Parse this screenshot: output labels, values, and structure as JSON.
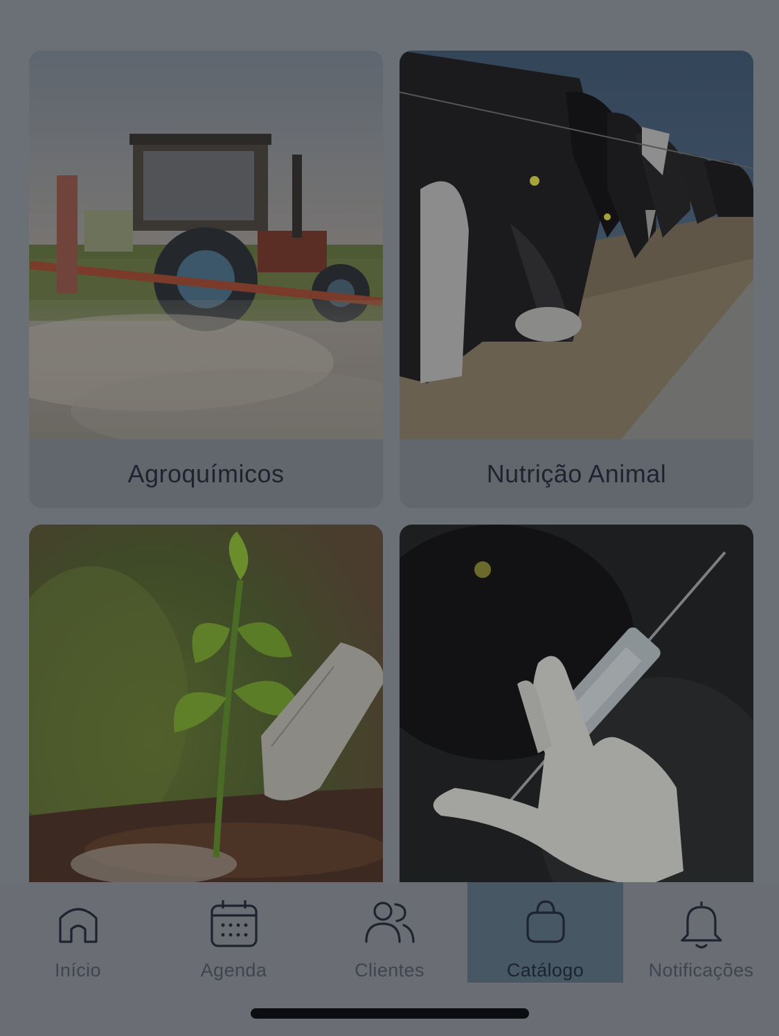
{
  "catalog": {
    "categories": [
      {
        "label": "Agroquímicos",
        "image": "tractor-spraying-field"
      },
      {
        "label": "Nutrição Animal",
        "image": "cows-feeding"
      },
      {
        "label": "",
        "image": "seedling-with-shovel"
      },
      {
        "label": "",
        "image": "veterinary-syringe"
      }
    ]
  },
  "tabbar": {
    "items": [
      {
        "label": "Início",
        "icon": "home-icon"
      },
      {
        "label": "Agenda",
        "icon": "calendar-icon"
      },
      {
        "label": "Clientes",
        "icon": "users-icon"
      },
      {
        "label": "Catálogo",
        "icon": "shopping-bag-icon",
        "active": true
      },
      {
        "label": "Notificações",
        "icon": "bell-icon"
      }
    ]
  },
  "colors": {
    "overlay_dim": "#6b6f76",
    "active_tab": "#475764",
    "label_dark": "#1d2430"
  }
}
